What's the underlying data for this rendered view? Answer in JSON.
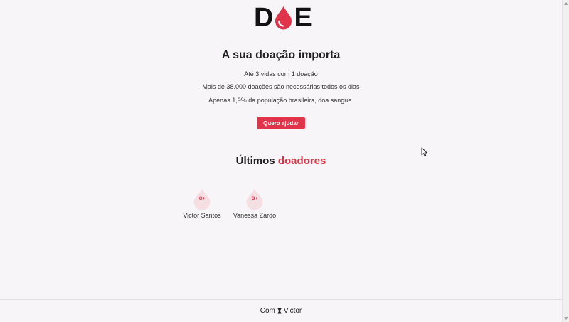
{
  "logo": {
    "letter_left": "D",
    "letter_right": "E",
    "icon": "blood-drop-icon"
  },
  "hero": {
    "title": "A sua doação importa",
    "facts": [
      "Até 3 vidas com 1 doação",
      "Mais de 38.000 doações são necessárias todos os dias",
      "Apenas 1,9% da população brasileira, doa sangue."
    ],
    "cta_label": "Quero ajudar"
  },
  "donors": {
    "title_prefix": "Últimos",
    "title_accent": "doadores",
    "items": [
      {
        "blood_type": "O+",
        "name": "Victor Santos"
      },
      {
        "blood_type": "B+",
        "name": "Vanessa Zardo"
      }
    ]
  },
  "footer": {
    "text_before": "Com",
    "icon": "hourglass-icon",
    "text_after": "Victor"
  },
  "colors": {
    "accent": "#e0344a",
    "background": "#f7f5f7",
    "drop_light": "#f6dfe3"
  }
}
